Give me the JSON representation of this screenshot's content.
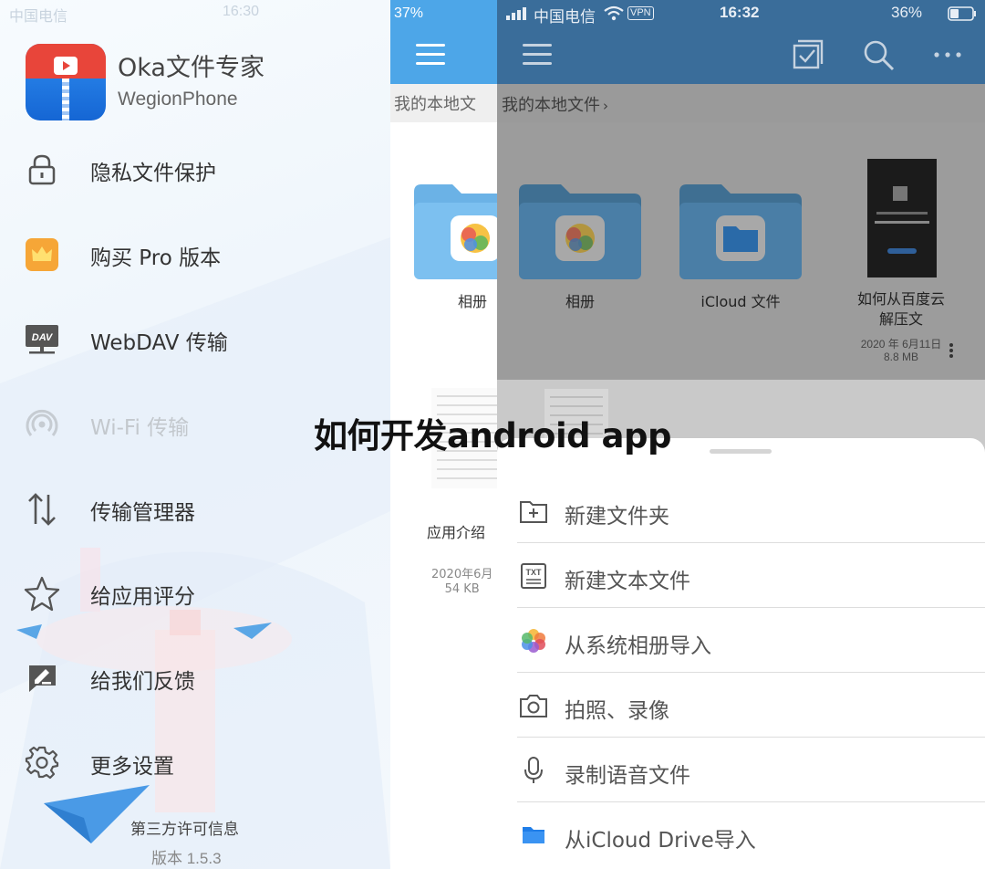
{
  "left_screen": {
    "status": {
      "carrier": "中国电信",
      "time": "16:30",
      "battery": "37%"
    },
    "app": {
      "name": "Oka文件专家",
      "developer": "WegionPhone"
    },
    "menu": [
      {
        "label": "隐私文件保护",
        "icon": "lock-icon",
        "enabled": true
      },
      {
        "label": "购买 Pro 版本",
        "icon": "crown-icon",
        "enabled": true
      },
      {
        "label": "WebDAV 传输",
        "icon": "dav-icon",
        "enabled": true
      },
      {
        "label": "Wi-Fi 传输",
        "icon": "wifi-signal-icon",
        "enabled": false
      },
      {
        "label": "传输管理器",
        "icon": "transfer-arrows-icon",
        "enabled": true
      },
      {
        "label": "给应用评分",
        "icon": "star-icon",
        "enabled": true
      },
      {
        "label": "给我们反馈",
        "icon": "feedback-icon",
        "enabled": true
      },
      {
        "label": "更多设置",
        "icon": "gear-icon",
        "enabled": true
      }
    ],
    "footer": {
      "license": "第三方许可信息",
      "version": "版本 1.5.3"
    },
    "background_list": {
      "breadcrumb": "我的本地文",
      "folder_label": "相册",
      "doc_label": "应用介绍",
      "doc_date": "2020年6月",
      "doc_size": "54 KB"
    }
  },
  "right_screen": {
    "status": {
      "carrier": "中国电信",
      "vpn": "VPN",
      "time": "16:32",
      "battery": "36%"
    },
    "breadcrumb": "我的本地文件",
    "files": [
      {
        "label": "相册",
        "icon": "photos-folder-icon"
      },
      {
        "label": "iCloud 文件",
        "icon": "icloud-folder-icon"
      },
      {
        "label": "如何从百度云解压文",
        "line1": "如何从百度云",
        "line2": "解压文",
        "date": "2020 年 6月11日",
        "size": "8.8 MB",
        "icon": "video-thumbnail"
      }
    ],
    "sheet": [
      {
        "label": "新建文件夹",
        "icon": "new-folder-icon"
      },
      {
        "label": "新建文本文件",
        "icon": "txt-file-icon"
      },
      {
        "label": "从系统相册导入",
        "icon": "photos-icon"
      },
      {
        "label": "拍照、录像",
        "icon": "camera-icon"
      },
      {
        "label": "录制语音文件",
        "icon": "microphone-icon"
      },
      {
        "label": "从iCloud Drive导入",
        "icon": "icloud-drive-icon"
      }
    ]
  },
  "overlay_title": "如何开发android app",
  "colors": {
    "header_blue": "#3a6d9a",
    "accent_blue": "#4da6e8",
    "dim_gray": "#9c9c9c",
    "disabled_text": "#c3c8cd"
  }
}
